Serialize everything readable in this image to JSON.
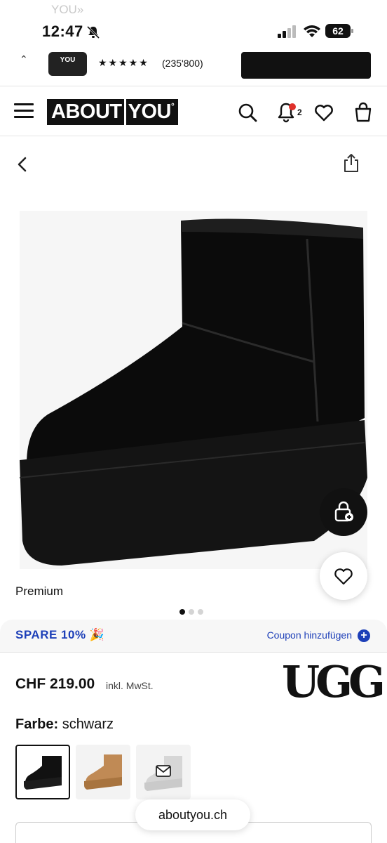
{
  "banner_remnant": "YOU»",
  "status": {
    "time": "12:47",
    "battery": "62"
  },
  "app_banner": {
    "app_name": "YOU",
    "stars": "★★★★★",
    "reviews": "(235'800)"
  },
  "header": {
    "logo_left": "ABOUT",
    "logo_right": "YOU",
    "notification_count": "2"
  },
  "product": {
    "label": "Premium",
    "promo": "SPARE 10% 🎉",
    "coupon": "Coupon hinzufügen",
    "price": "CHF 219.00",
    "vat": "inkl. MwSt.",
    "brand": "UGG",
    "color_label": "Farbe:",
    "color_value": "schwarz",
    "swatches": [
      "black",
      "chestnut",
      "notify"
    ]
  },
  "browser": {
    "url": "aboutyou.ch"
  },
  "colors": {
    "accent": "#1d3fb8",
    "badge": "#e0312b"
  }
}
